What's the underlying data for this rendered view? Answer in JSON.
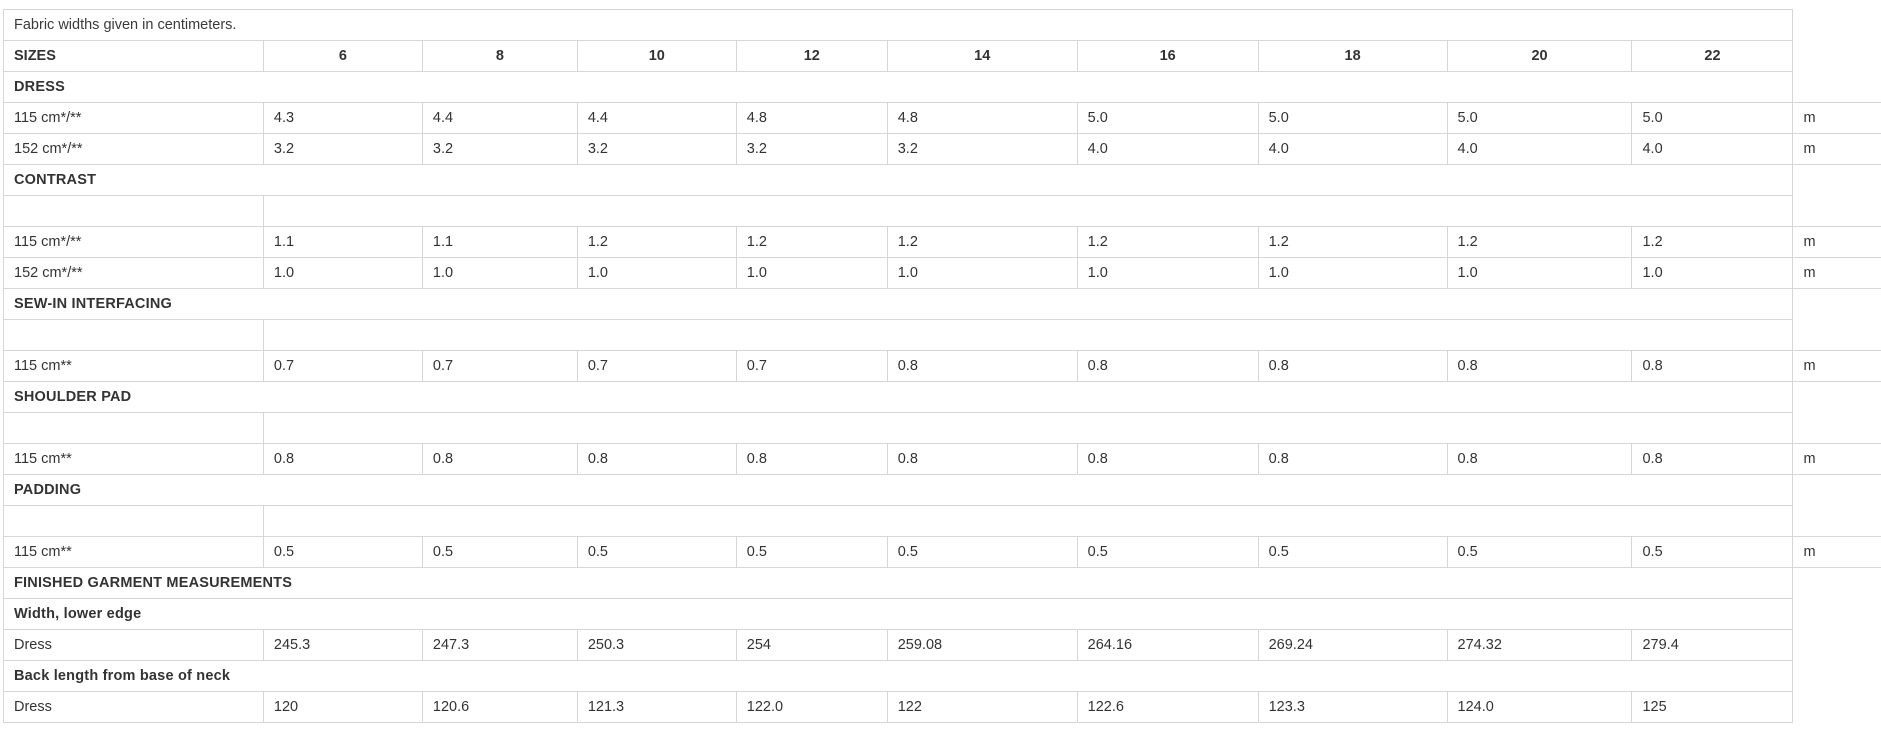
{
  "note": "Fabric widths given in centimeters.",
  "sizes_label": "SIZES",
  "sizes": [
    "6",
    "8",
    "10",
    "12",
    "14",
    "16",
    "18",
    "20",
    "22"
  ],
  "unit": "m",
  "sections": [
    {
      "title": "DRESS",
      "spacer": false,
      "rows": [
        {
          "label": "115 cm*/**",
          "values": [
            "4.3",
            "4.4",
            "4.4",
            "4.8",
            "4.8",
            "5.0",
            "5.0",
            "5.0",
            "5.0"
          ],
          "unit": true
        },
        {
          "label": "152 cm*/**",
          "values": [
            "3.2",
            "3.2",
            "3.2",
            "3.2",
            "3.2",
            "4.0",
            "4.0",
            "4.0",
            "4.0"
          ],
          "unit": true
        }
      ]
    },
    {
      "title": "CONTRAST",
      "spacer": true,
      "rows": [
        {
          "label": "115 cm*/**",
          "values": [
            "1.1",
            "1.1",
            "1.2",
            "1.2",
            "1.2",
            "1.2",
            "1.2",
            "1.2",
            "1.2"
          ],
          "unit": true
        },
        {
          "label": "152 cm*/**",
          "values": [
            "1.0",
            "1.0",
            "1.0",
            "1.0",
            "1.0",
            "1.0",
            "1.0",
            "1.0",
            "1.0"
          ],
          "unit": true
        }
      ]
    },
    {
      "title": "SEW-IN INTERFACING",
      "spacer": true,
      "rows": [
        {
          "label": "115 cm**",
          "values": [
            "0.7",
            "0.7",
            "0.7",
            "0.7",
            "0.8",
            "0.8",
            "0.8",
            "0.8",
            "0.8"
          ],
          "unit": true
        }
      ]
    },
    {
      "title": "SHOULDER PAD",
      "spacer": true,
      "rows": [
        {
          "label": "115 cm**",
          "values": [
            "0.8",
            "0.8",
            "0.8",
            "0.8",
            "0.8",
            "0.8",
            "0.8",
            "0.8",
            "0.8"
          ],
          "unit": true
        }
      ]
    },
    {
      "title": "PADDING",
      "spacer": true,
      "rows": [
        {
          "label": "115 cm**",
          "values": [
            "0.5",
            "0.5",
            "0.5",
            "0.5",
            "0.5",
            "0.5",
            "0.5",
            "0.5",
            "0.5"
          ],
          "unit": true
        }
      ]
    },
    {
      "title": "FINISHED GARMENT MEASUREMENTS",
      "spacer": false,
      "rows": []
    },
    {
      "title": "Width, lower edge",
      "spacer": false,
      "rows": [
        {
          "label": "Dress",
          "values": [
            "245.3",
            "247.3",
            "250.3",
            "254",
            "259.08",
            "264.16",
            "269.24",
            "274.32",
            "279.4"
          ],
          "unit": false
        }
      ]
    },
    {
      "title": "Back length from base of neck",
      "spacer": false,
      "rows": [
        {
          "label": "Dress",
          "values": [
            "120",
            "120.6",
            "121.3",
            "122.0",
            "122",
            "122.6",
            "123.3",
            "124.0",
            "125"
          ],
          "unit": false
        }
      ]
    }
  ]
}
